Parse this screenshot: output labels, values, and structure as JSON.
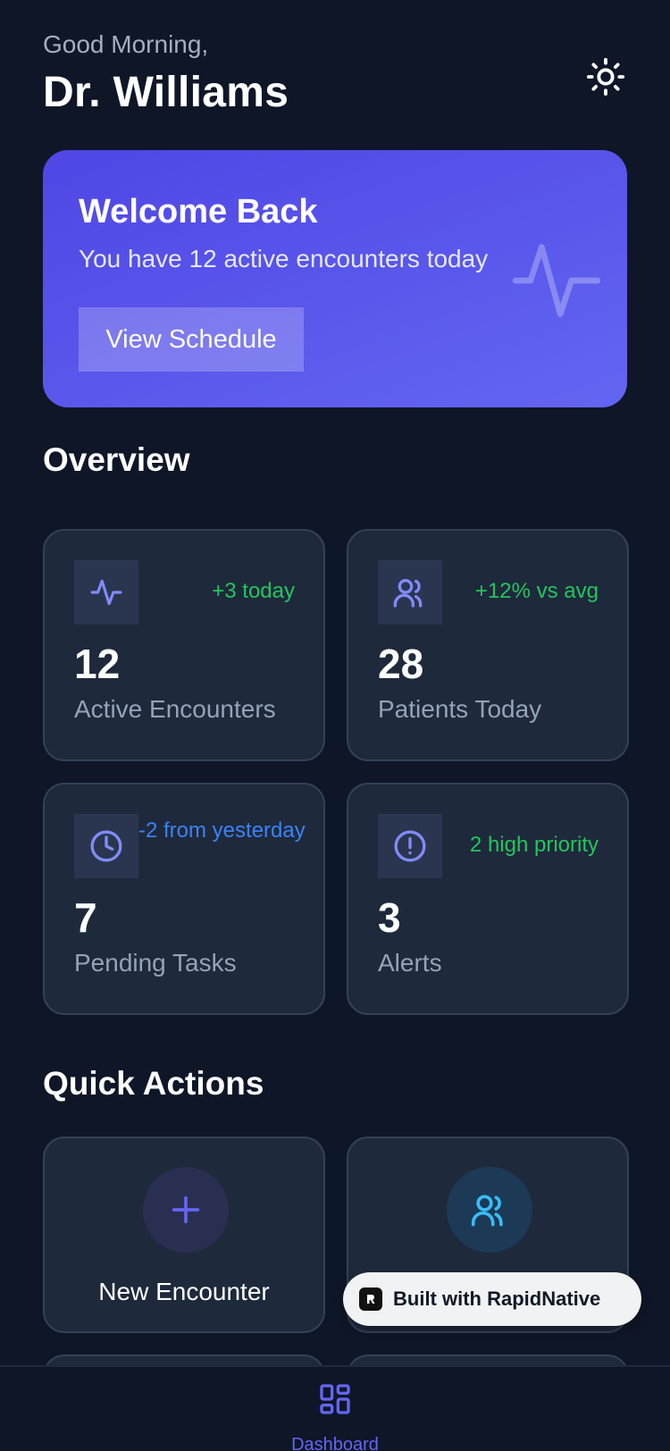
{
  "header": {
    "greeting": "Good Morning,",
    "name": "Dr. Williams",
    "theme_icon": "sun-icon"
  },
  "welcome": {
    "title": "Welcome Back",
    "subtitle": "You have 12 active encounters today",
    "button_label": "View Schedule",
    "decor_icon": "pulse-icon"
  },
  "overview": {
    "title": "Overview",
    "stats": [
      {
        "icon": "activity-icon",
        "trend": "+3 today",
        "value": "12",
        "label": "Active Encounters"
      },
      {
        "icon": "users-icon",
        "trend": "+12% vs avg",
        "value": "28",
        "label": "Patients Today"
      },
      {
        "icon": "clock-icon",
        "trend": "-2 from yesterday",
        "value": "7",
        "label": "Pending Tasks"
      },
      {
        "icon": "alert-circle-icon",
        "trend": "2 high priority",
        "value": "3",
        "label": "Alerts"
      }
    ]
  },
  "quick_actions": {
    "title": "Quick Actions",
    "items": [
      {
        "icon": "plus-icon",
        "label": "New Encounter"
      },
      {
        "icon": "users-icon",
        "label": ""
      }
    ]
  },
  "badge": {
    "label": "Built with RapidNative"
  },
  "nav": {
    "items": [
      {
        "icon": "dashboard-grid-icon",
        "label": "Dashboard"
      }
    ]
  },
  "colors": {
    "background": "#0f1628",
    "card": "#1e293b",
    "accent": "#6366f1",
    "positive": "#22c55e",
    "info": "#3b82f6"
  }
}
